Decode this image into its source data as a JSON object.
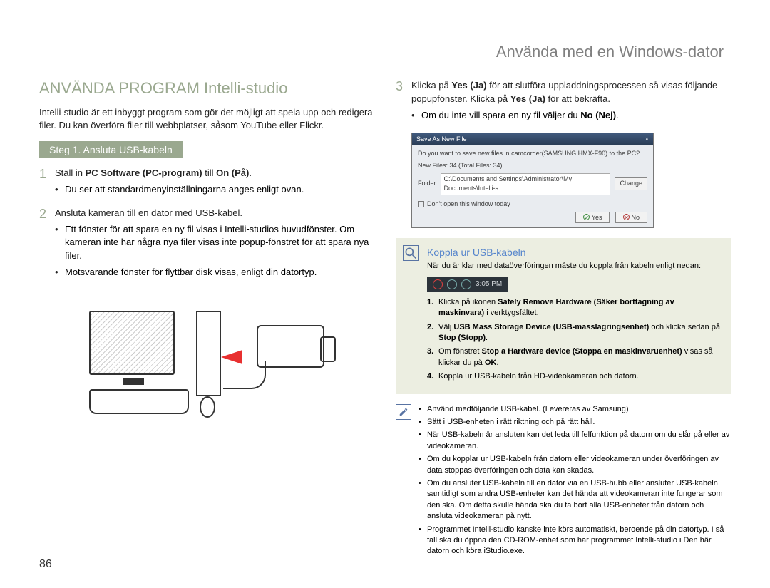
{
  "header": {
    "title": "Använda med en Windows-dator"
  },
  "left": {
    "heading": "ANVÄNDA PROGRAM Intelli-studio",
    "intro": "Intelli-studio är ett inbyggt program som gör det möjligt att spela upp och redigera filer. Du kan överföra filer till webbplatser, såsom YouTube eller Flickr.",
    "step_title": "Steg 1. Ansluta USB-kabeln",
    "item1": {
      "pre": "Ställ in ",
      "b1": "PC Software (PC-program)",
      "mid": " till ",
      "b2": "On (På)",
      "post": ".",
      "bullet1": "Du ser att standardmenyinställningarna anges enligt ovan."
    },
    "item2": {
      "text": "Ansluta kameran till en dator med USB-kabel.",
      "bullet1": "Ett fönster för att spara en ny fil visas i Intelli-studios huvudfönster. Om kameran inte har några nya filer visas inte popup-fönstret för att spara nya filer.",
      "bullet2": "Motsvarande fönster för flyttbar disk visas, enligt din datortyp."
    }
  },
  "right": {
    "item3": {
      "pre": "Klicka på ",
      "b1": "Yes (Ja)",
      "mid1": " för att slutföra uppladdningsprocessen så visas följande popupfönster. Klicka på ",
      "b2": "Yes (Ja)",
      "mid2": " för att bekräfta.",
      "bullet_pre": "Om du inte vill spara en ny fil väljer du ",
      "bullet_b": "No (Nej)",
      "bullet_post": "."
    },
    "dialog": {
      "title": "Save As New File",
      "close": "×",
      "msg": "Do you want to save new files in camcorder(SAMSUNG HMX-F90) to the PC?",
      "newfiles_label": "New Files: 34 (Total Files: 34)",
      "folder_label": "Folder",
      "folder_path": "C:\\Documents and Settings\\Administrator\\My Documents\\Intelli-s",
      "change_btn": "Change",
      "checkbox": "Don't open this window today",
      "yes": "Yes",
      "no": "No"
    },
    "tip": {
      "title": "Koppla ur USB-kabeln",
      "text": "När du är klar med dataöverföringen måste du koppla från kabeln enligt nedan:",
      "clock": "3:05 PM",
      "ol1_pre": "Klicka på ikonen ",
      "ol1_b": "Safely Remove Hardware (Säker borttagning av maskinvara)",
      "ol1_post": " i verktygsfältet.",
      "ol2_pre": "Välj ",
      "ol2_b1": "USB Mass Storage Device (USB-masslagringsenhet)",
      "ol2_mid": " och klicka sedan på ",
      "ol2_b2": "Stop (Stopp)",
      "ol2_post": ".",
      "ol3_pre": "Om fönstret ",
      "ol3_b1": "Stop a Hardware device (Stoppa en maskinvaruenhet)",
      "ol3_mid": " visas så klickar du på ",
      "ol3_b2": "OK",
      "ol3_post": ".",
      "ol4": "Koppla ur USB-kabeln från HD-videokameran och datorn."
    },
    "notes": {
      "n1": "Använd medföljande USB-kabel. (Levereras av Samsung)",
      "n2": "Sätt i USB-enheten i rätt riktning och på rätt håll.",
      "n3": "När USB-kabeln är ansluten kan det leda till felfunktion på datorn om du slår på eller av videokameran.",
      "n4": "Om du kopplar ur USB-kabeln från datorn eller videokameran under överföringen av data stoppas överföringen och data kan skadas.",
      "n5": "Om du ansluter USB-kabeln till en dator via en USB-hubb eller ansluter USB-kabeln samtidigt som andra USB-enheter kan det hända att videokameran inte fungerar som den ska. Om detta skulle hända ska du ta bort alla USB-enheter från datorn och ansluta videokameran på nytt.",
      "n6": "Programmet Intelli-studio kanske inte körs automatiskt, beroende på din datortyp. I så fall ska du öppna den CD-ROM-enhet som har programmet Intelli-studio i Den här datorn och köra iStudio.exe."
    }
  },
  "page_num": "86"
}
